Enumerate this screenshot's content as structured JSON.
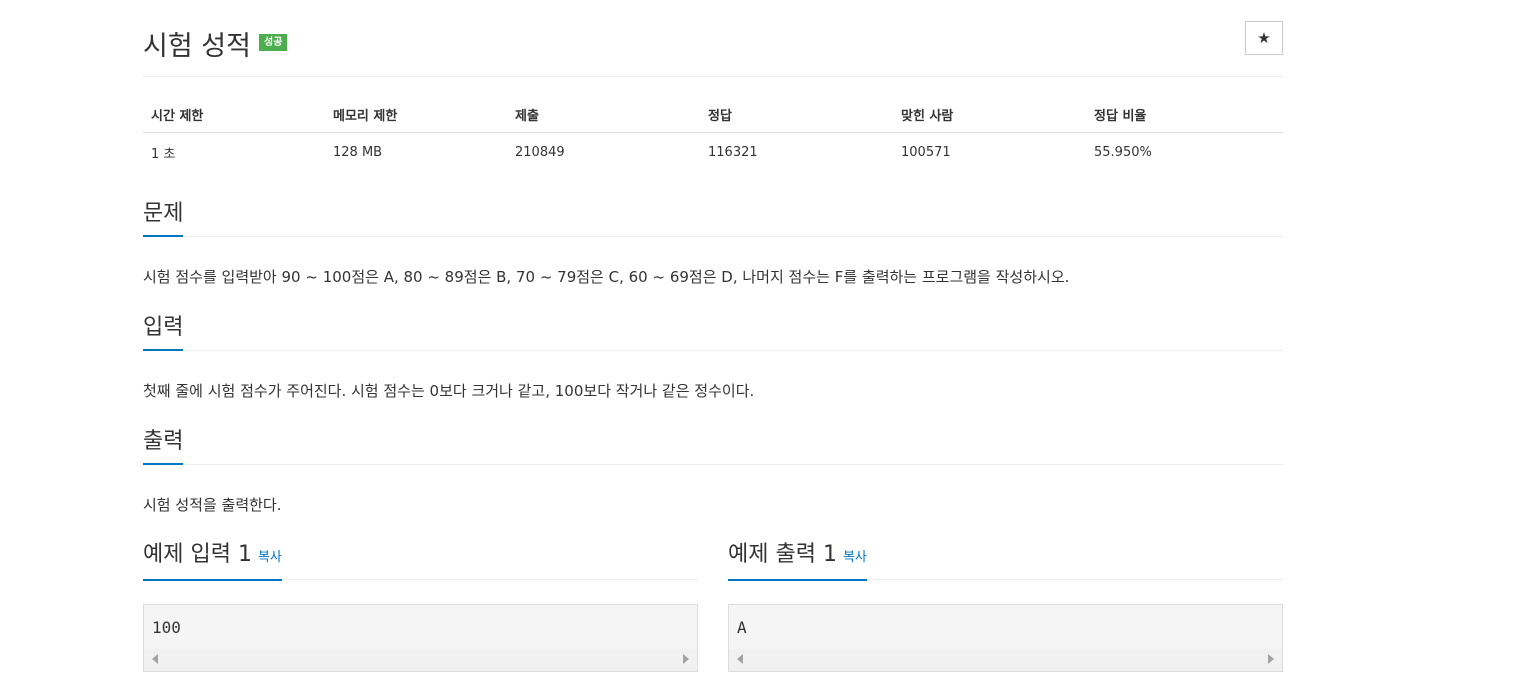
{
  "problem": {
    "title": "시험 성적",
    "badge": "성공",
    "star_icon": "★"
  },
  "info_table": {
    "headers": [
      "시간 제한",
      "메모리 제한",
      "제출",
      "정답",
      "맞힌 사람",
      "정답 비율"
    ],
    "values": [
      "1 초",
      "128 MB",
      "210849",
      "116321",
      "100571",
      "55.950%"
    ]
  },
  "sections": {
    "description": {
      "heading": "문제",
      "text": "시험 점수를 입력받아 90 ~ 100점은 A, 80 ~ 89점은 B, 70 ~ 79점은 C, 60 ~ 69점은 D, 나머지 점수는 F를 출력하는 프로그램을 작성하시오."
    },
    "input": {
      "heading": "입력",
      "text": "첫째 줄에 시험 점수가 주어진다. 시험 점수는 0보다 크거나 같고, 100보다 작거나 같은 정수이다."
    },
    "output": {
      "heading": "출력",
      "text": "시험 성적을 출력한다."
    }
  },
  "samples": {
    "input": {
      "heading": "예제 입력 1",
      "copy_label": "복사",
      "content": "100"
    },
    "output": {
      "heading": "예제 출력 1",
      "copy_label": "복사",
      "content": "A"
    }
  },
  "colors": {
    "accent": "#0076c0",
    "badge": "#4cae4c"
  }
}
